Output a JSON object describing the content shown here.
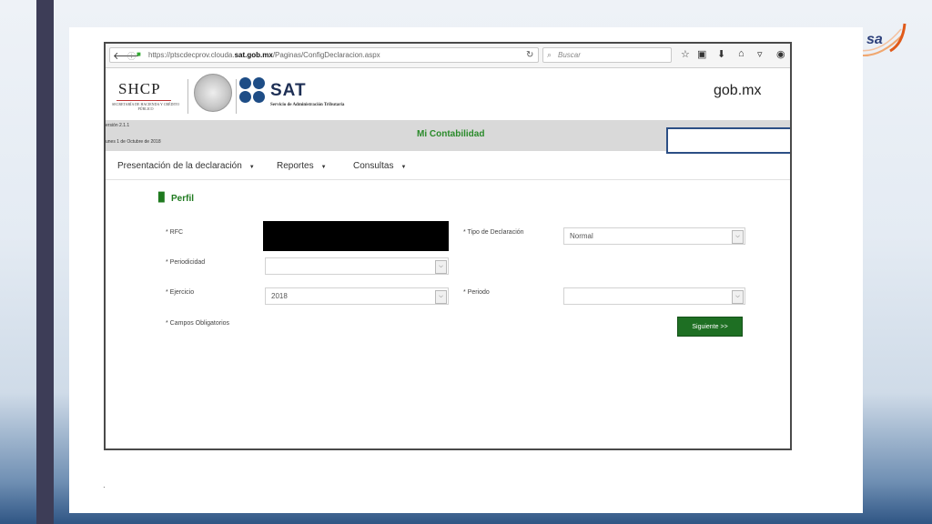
{
  "browser": {
    "url_prefix": "https://ptscdecprov.clouda.",
    "url_domain": "sat.gob.mx",
    "url_path": "/Paginas/ConfigDeclaracion.aspx",
    "search_placeholder": "Buscar"
  },
  "header": {
    "shcp": "SHCP",
    "shcp_sub": "SECRETARÍA DE HACIENDA Y CRÉDITO PÚBLICO",
    "sat": "SAT",
    "sat_sub": "Servicio de Administración Tributaria",
    "gob": "gob.mx"
  },
  "app_bar": {
    "version": "ersión 2.1.1",
    "date": "unes 1 de Octubre de 2018",
    "title": "Mi Contabilidad"
  },
  "menu": [
    {
      "label": "Presentación de la declaración"
    },
    {
      "label": "Reportes"
    },
    {
      "label": "Consultas"
    }
  ],
  "section_title": "Perfil",
  "form": {
    "rfc_label": "* RFC",
    "tipo_label": "* Tipo de Declaración",
    "tipo_value": "Normal",
    "periodicidad_label": "* Periodicidad",
    "periodicidad_value": "",
    "ejercicio_label": "* Ejercicio",
    "ejercicio_value": "2018",
    "periodo_label": "* Periodo",
    "periodo_value": "",
    "required_note": "* Campos Obligatorios",
    "next_button": "Siguiente >>"
  },
  "colors": {
    "accent_green": "#1e6f23",
    "highlight_blue": "#2c4f85",
    "sat_blue": "#1e4d86"
  }
}
